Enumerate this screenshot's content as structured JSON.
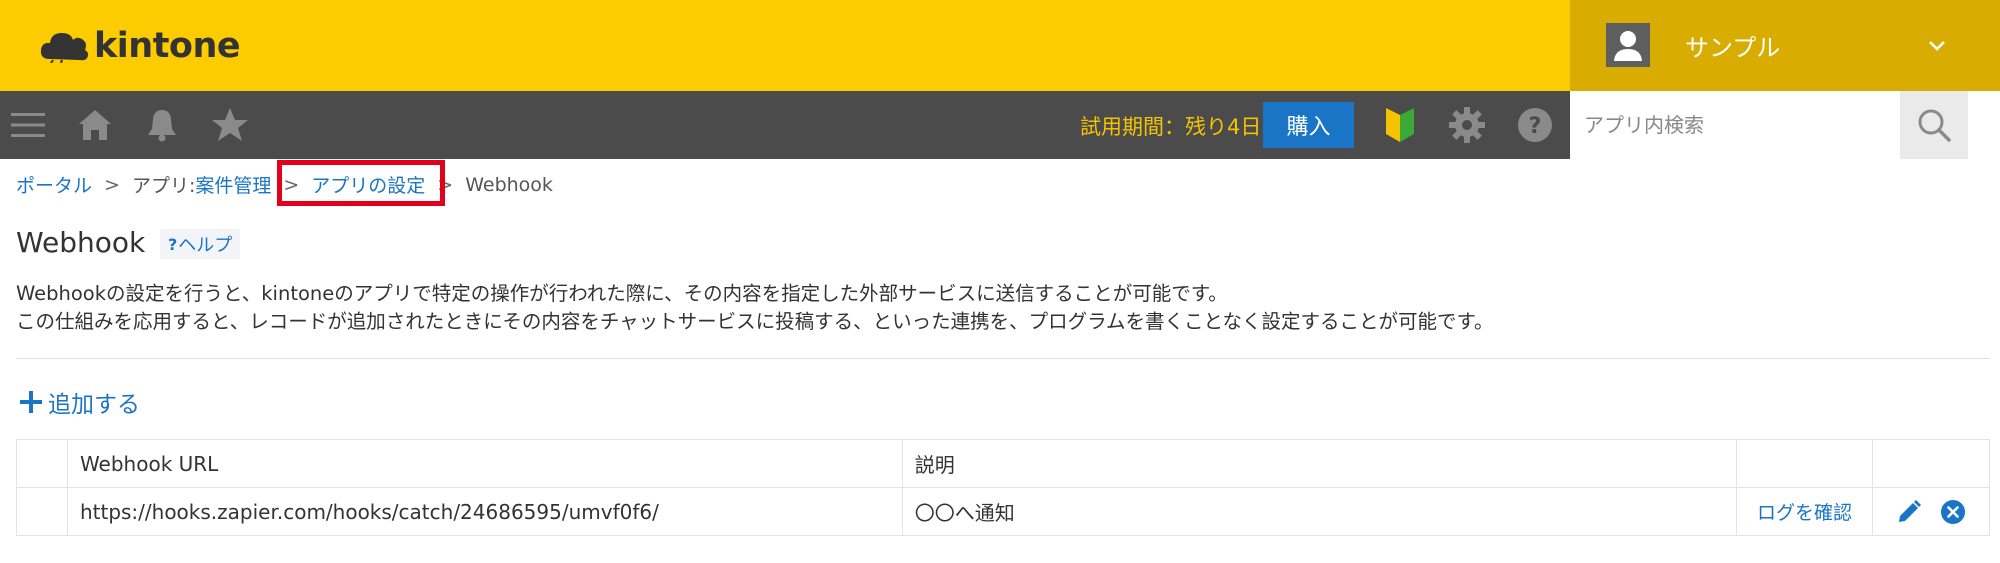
{
  "header": {
    "logo_text": "kintone",
    "user_name": "サンプル",
    "brand_color": "#fccb00"
  },
  "navbar": {
    "trial_text": "試用期間：残り4日",
    "buy_label": "購入",
    "search_placeholder": "アプリ内検索",
    "icons": [
      "menu-icon",
      "home-icon",
      "bell-icon",
      "star-icon",
      "beginner-mark-icon",
      "gear-icon",
      "help-icon",
      "search-icon"
    ]
  },
  "breadcrumb": {
    "portal": "ポータル",
    "app_prefix": "アプリ: ",
    "app_name": "案件管理",
    "app_settings": "アプリの設定",
    "current": "Webhook",
    "separator": ">"
  },
  "page": {
    "title": "Webhook",
    "help_label": "ヘルプ",
    "help_prefix": "?",
    "description_line1": "Webhookの設定を行うと、kintoneのアプリで特定の操作が行われた際に、その内容を指定した外部サービスに送信することが可能です。",
    "description_line2": "この仕組みを応用すると、レコードが追加されたときにその内容をチャットサービスに投稿する、といった連携を、プログラムを書くことなく設定することが可能です。",
    "add_label": "追加する"
  },
  "table": {
    "headers": [
      "",
      "Webhook URL",
      "説明",
      "",
      ""
    ],
    "rows": [
      {
        "url": "https://hooks.zapier.com/hooks/catch/24686595/umvf0f6/",
        "description": "〇〇へ通知",
        "log_label": "ログを確認"
      }
    ]
  }
}
